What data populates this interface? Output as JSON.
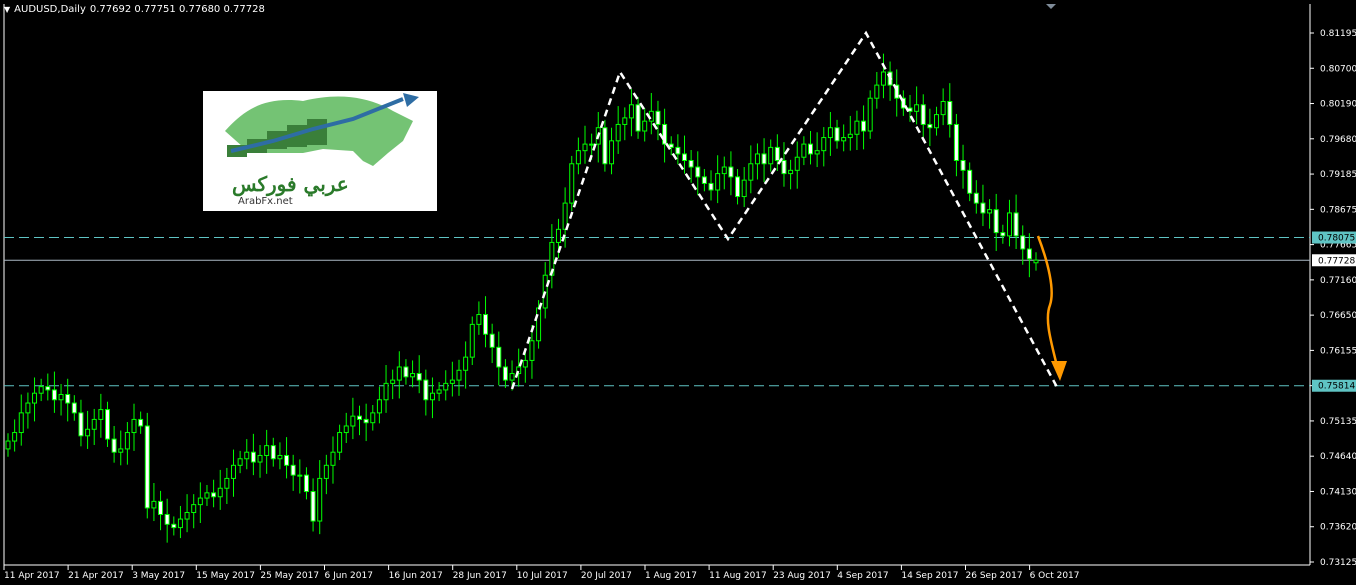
{
  "header": {
    "symbol_label": "AUDUSD,Daily",
    "ohlc": "0.77692 0.77751 0.77680 0.77728",
    "dropdown_icon": "triangle-down-icon"
  },
  "logo": {
    "arabic": "عربي فوركس",
    "url_text": "ArabFx.net"
  },
  "price_axis": {
    "ticks": [
      "0.81195",
      "0.80700",
      "0.80190",
      "0.79680",
      "0.79185",
      "0.78675",
      "0.77665",
      "0.77160",
      "0.76650",
      "0.76155",
      "0.75645",
      "0.75135",
      "0.74640",
      "0.74130",
      "0.73620",
      "0.73125"
    ],
    "ylim": [
      0.73125,
      0.81195
    ]
  },
  "price_labels": [
    {
      "value": "0.78075",
      "price": 0.78075,
      "color": "#5fc4c4",
      "bg": "#5fc4c4",
      "fg": "#000"
    },
    {
      "value": "0.77728",
      "price": 0.77728,
      "color": "#aab7c4",
      "bg": "#ffffff",
      "fg": "#000"
    },
    {
      "value": "0.75814",
      "price": 0.75814,
      "color": "#5fc4c4",
      "bg": "#5fc4c4",
      "fg": "#000"
    }
  ],
  "time_axis": {
    "labels": [
      "11 Apr 2017",
      "21 Apr 2017",
      "3 May 2017",
      "15 May 2017",
      "25 May 2017",
      "6 Jun 2017",
      "16 Jun 2017",
      "28 Jun 2017",
      "10 Jul 2017",
      "20 Jul 2017",
      "1 Aug 2017",
      "11 Aug 2017",
      "23 Aug 2017",
      "4 Sep 2017",
      "14 Sep 2017",
      "26 Sep 2017",
      "6 Oct 2017"
    ]
  },
  "colors": {
    "bull": "#000000",
    "bear": "#ffffff",
    "wick": "#00ff00",
    "pattern": "#ffffff",
    "arrow": "#ff9900"
  },
  "chart_data": {
    "type": "candlestick",
    "title": "AUDUSD,Daily",
    "ylim": [
      0.73125,
      0.81195
    ],
    "x_ticks": [
      "11 Apr 2017",
      "21 Apr 2017",
      "3 May 2017",
      "15 May 2017",
      "25 May 2017",
      "6 Jun 2017",
      "16 Jun 2017",
      "28 Jun 2017",
      "10 Jul 2017",
      "20 Jul 2017",
      "1 Aug 2017",
      "11 Aug 2017",
      "23 Aug 2017",
      "4 Sep 2017",
      "14 Sep 2017",
      "26 Sep 2017",
      "6 Oct 2017"
    ],
    "close": [
      0.7497,
      0.751,
      0.754,
      0.7555,
      0.757,
      0.758,
      0.7575,
      0.756,
      0.7568,
      0.7555,
      0.754,
      0.7505,
      0.7515,
      0.753,
      0.7545,
      0.75,
      0.748,
      0.7485,
      0.751,
      0.753,
      0.752,
      0.7395,
      0.7405,
      0.7385,
      0.737,
      0.7365,
      0.7378,
      0.7388,
      0.74,
      0.741,
      0.7418,
      0.7412,
      0.7425,
      0.744,
      0.746,
      0.747,
      0.748,
      0.7465,
      0.7475,
      0.749,
      0.747,
      0.7475,
      0.746,
      0.7445,
      0.7445,
      0.742,
      0.7375,
      0.744,
      0.746,
      0.748,
      0.751,
      0.752,
      0.7535,
      0.753,
      0.7525,
      0.754,
      0.756,
      0.7585,
      0.759,
      0.761,
      0.7595,
      0.76,
      0.759,
      0.756,
      0.757,
      0.7575,
      0.7585,
      0.759,
      0.7605,
      0.7625,
      0.7675,
      0.769,
      0.766,
      0.764,
      0.761,
      0.759,
      0.76,
      0.761,
      0.762,
      0.765,
      0.77,
      0.775,
      0.78,
      0.782,
      0.786,
      0.792,
      0.794,
      0.795,
      0.795,
      0.7975,
      0.792,
      0.7955,
      0.798,
      0.799,
      0.801,
      0.797,
      0.7985,
      0.8,
      0.798,
      0.795,
      0.7945,
      0.7935,
      0.7925,
      0.7915,
      0.79,
      0.789,
      0.788,
      0.7905,
      0.7915,
      0.79,
      0.787,
      0.7895,
      0.792,
      0.7935,
      0.792,
      0.7945,
      0.7925,
      0.7905,
      0.791,
      0.793,
      0.795,
      0.7935,
      0.794,
      0.796,
      0.7975,
      0.7955,
      0.796,
      0.7965,
      0.7985,
      0.797,
      0.802,
      0.804,
      0.806,
      0.804,
      0.802,
      0.8005,
      0.8,
      0.801,
      0.798,
      0.7975,
      0.7995,
      0.8015,
      0.798,
      0.7925,
      0.791,
      0.7875,
      0.786,
      0.7845,
      0.785,
      0.7815,
      0.781,
      0.7845,
      0.781,
      0.779,
      0.7775,
      0.7773
    ],
    "open": [
      0.7485,
      0.7497,
      0.751,
      0.754,
      0.7555,
      0.757,
      0.758,
      0.7575,
      0.756,
      0.7568,
      0.7555,
      0.754,
      0.7505,
      0.7515,
      0.753,
      0.7545,
      0.75,
      0.748,
      0.7485,
      0.751,
      0.753,
      0.752,
      0.7395,
      0.7405,
      0.7385,
      0.737,
      0.7365,
      0.7378,
      0.7388,
      0.74,
      0.741,
      0.7418,
      0.7412,
      0.7425,
      0.744,
      0.746,
      0.747,
      0.748,
      0.7465,
      0.7475,
      0.749,
      0.747,
      0.7475,
      0.746,
      0.7445,
      0.7445,
      0.742,
      0.7375,
      0.744,
      0.746,
      0.748,
      0.751,
      0.752,
      0.7535,
      0.753,
      0.7525,
      0.754,
      0.756,
      0.7585,
      0.759,
      0.761,
      0.7595,
      0.76,
      0.759,
      0.756,
      0.757,
      0.7575,
      0.7585,
      0.759,
      0.7605,
      0.7625,
      0.7675,
      0.769,
      0.766,
      0.764,
      0.761,
      0.759,
      0.76,
      0.761,
      0.762,
      0.765,
      0.77,
      0.775,
      0.78,
      0.782,
      0.786,
      0.792,
      0.794,
      0.795,
      0.795,
      0.7975,
      0.792,
      0.7955,
      0.798,
      0.799,
      0.801,
      0.797,
      0.7985,
      0.8,
      0.798,
      0.795,
      0.7945,
      0.7935,
      0.7925,
      0.7915,
      0.79,
      0.789,
      0.788,
      0.7905,
      0.7915,
      0.79,
      0.787,
      0.7895,
      0.792,
      0.7935,
      0.792,
      0.7945,
      0.7925,
      0.7905,
      0.791,
      0.793,
      0.795,
      0.7935,
      0.794,
      0.796,
      0.7975,
      0.7955,
      0.796,
      0.7965,
      0.7985,
      0.797,
      0.802,
      0.804,
      0.806,
      0.804,
      0.802,
      0.8005,
      0.8,
      0.801,
      0.798,
      0.7975,
      0.7995,
      0.8015,
      0.798,
      0.7925,
      0.791,
      0.7875,
      0.786,
      0.7845,
      0.785,
      0.7815,
      0.781,
      0.7845,
      0.781,
      0.779,
      0.7769
    ]
  }
}
